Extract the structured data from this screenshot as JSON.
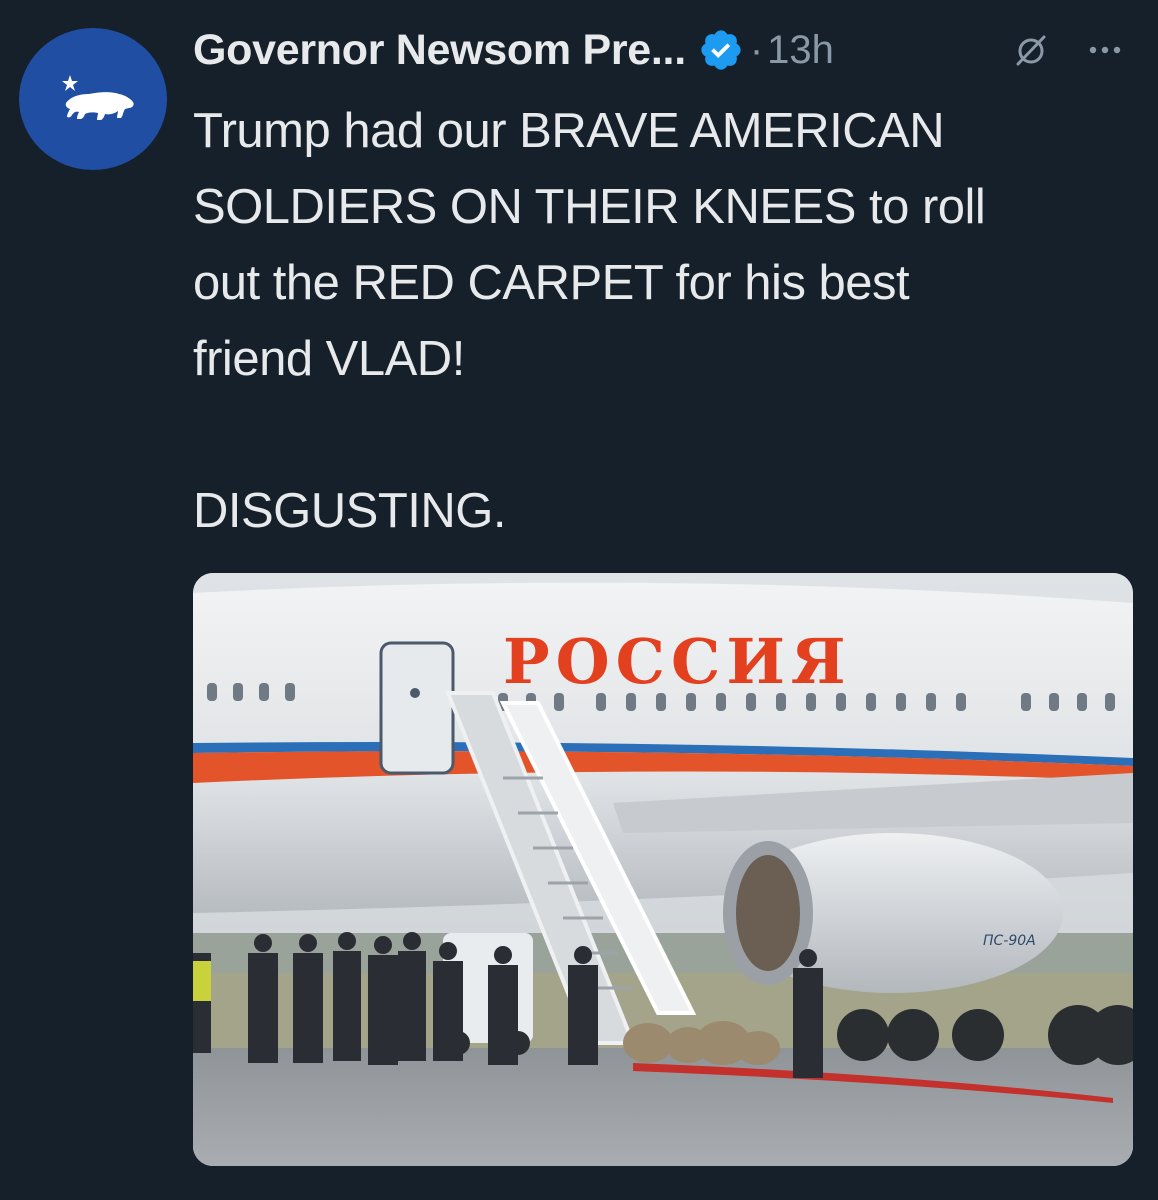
{
  "tweet": {
    "author_name": "Governor Newsom Pre...",
    "separator": "·",
    "timestamp": "13h",
    "text_lines": [
      "Trump had our BRAVE AMERICAN",
      "SOLDIERS ON THEIR KNEES to roll",
      "out the RED CARPET for his best",
      "friend VLAD!"
    ],
    "text_closing": "DISGUSTING.",
    "media": {
      "plane_lettering": "РОССИЯ",
      "engine_marking": "ПС-90А"
    }
  },
  "icons": {
    "avatar": "california-bear-star-icon",
    "verified": "verified-badge-icon",
    "grok": "grok-icon",
    "more": "more-dots-icon"
  },
  "colors": {
    "background": "#15202b",
    "text_primary": "#e7e9ea",
    "text_secondary": "#8b98a5",
    "verified_blue": "#1d9bf0",
    "avatar_blue": "#1f4ea3"
  }
}
